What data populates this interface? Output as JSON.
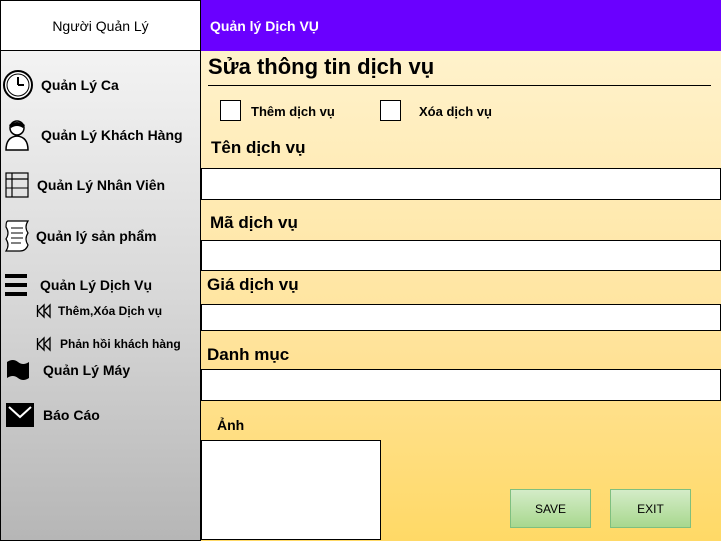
{
  "sidebar": {
    "header": "Người Quản Lý",
    "items": [
      {
        "label": "Quản Lý Ca",
        "icon": "clock-icon"
      },
      {
        "label": "Quản Lý Khách Hàng",
        "icon": "user-icon"
      },
      {
        "label": "Quản Lý Nhân Viên",
        "icon": "table-icon"
      },
      {
        "label": "Quản lý sản phẩm",
        "icon": "scroll-icon"
      },
      {
        "label": "Quản Lý Dịch Vụ",
        "icon": "menu-icon"
      },
      {
        "label": "Quản Lý Máy",
        "icon": "wave-flag-icon"
      },
      {
        "label": "Báo Cáo",
        "icon": "mail-icon"
      }
    ],
    "sub_items": [
      {
        "label": "Thêm,Xóa Dịch vụ",
        "icon": "rewind-icon"
      },
      {
        "label": "Phản hồi khách hàng",
        "icon": "rewind-icon"
      }
    ]
  },
  "topbar": {
    "title": "Quản lý Dịch VỤ"
  },
  "main": {
    "title": "Sửa thông tin dịch vụ",
    "checkboxes": [
      {
        "label": "Thêm dịch vụ",
        "checked": false
      },
      {
        "label": "Xóa dịch vụ",
        "checked": false
      }
    ],
    "fields": [
      {
        "label": "Tên dịch vụ",
        "value": ""
      },
      {
        "label": "Mã dịch vụ",
        "value": ""
      },
      {
        "label": "Giá dịch vụ",
        "value": ""
      },
      {
        "label": "Danh mục",
        "value": ""
      }
    ],
    "image_label": "Ảnh",
    "buttons": {
      "save": "SAVE",
      "exit": "EXIT"
    }
  }
}
